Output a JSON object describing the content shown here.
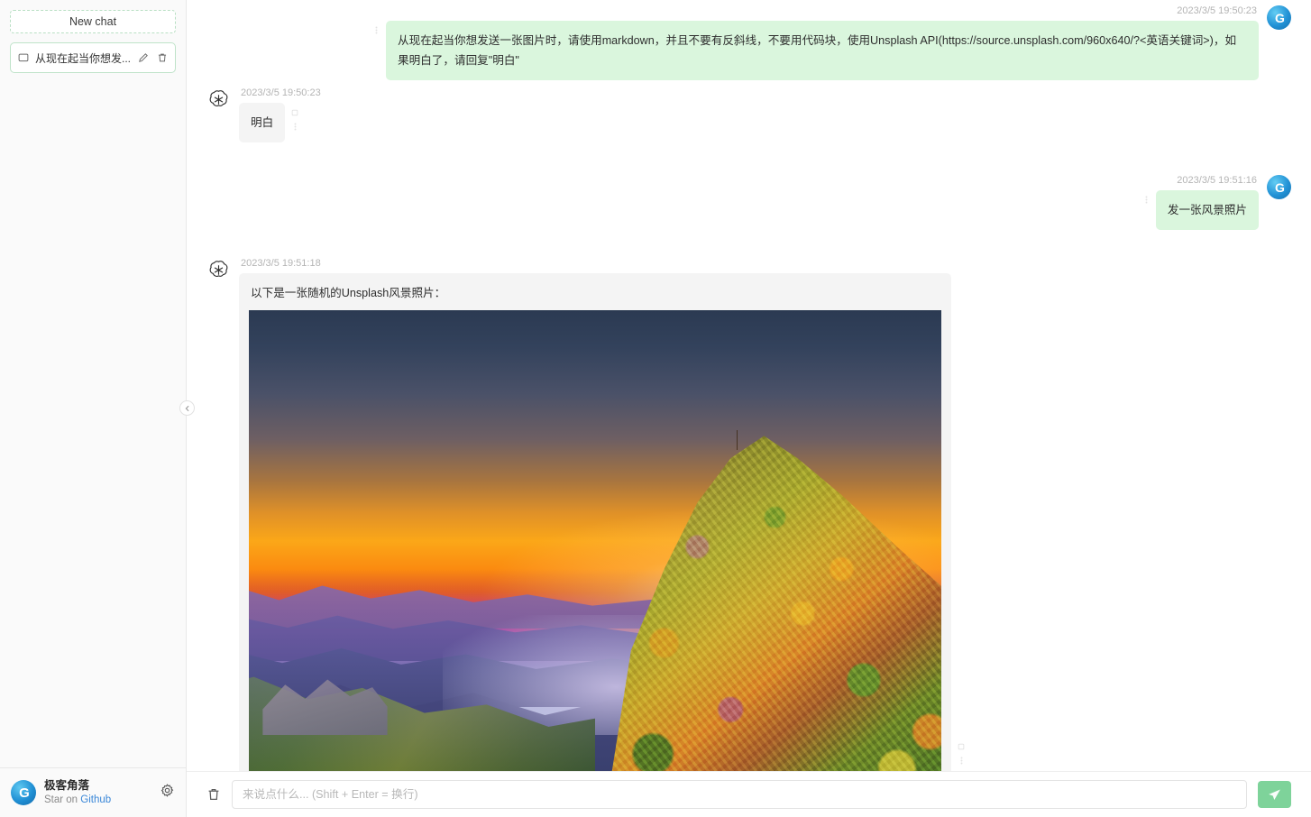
{
  "sidebar": {
    "new_chat_label": "New chat",
    "chats": [
      {
        "title": "从现在起当你想发...",
        "icon": "message-icon",
        "edit_icon": "pencil-icon",
        "delete_icon": "trash-icon"
      }
    ],
    "footer": {
      "brand_name": "极客角落",
      "star_prefix": "Star on ",
      "star_link": "Github",
      "settings_icon": "gear-icon",
      "logo_letter": "G"
    },
    "collapse_icon": "chevron-left-icon"
  },
  "header": {
    "user_avatar_letter": "G"
  },
  "conversation": [
    {
      "role": "user",
      "timestamp": "2023/3/5 19:50:23",
      "text": "从现在起当你想发送一张图片时，请使用markdown，并且不要有反斜线，不要用代码块，使用Unsplash API(https://source.unsplash.com/960x640/?<英语关键词>)，如果明白了，请回复\"明白\""
    },
    {
      "role": "assistant",
      "timestamp": "2023/3/5 19:50:23",
      "text": "明白"
    },
    {
      "role": "user",
      "timestamp": "2023/3/5 19:51:16",
      "text": "发一张风景照片"
    },
    {
      "role": "assistant",
      "timestamp": "2023/3/5 19:51:18",
      "text": "以下是一张随机的Unsplash风景照片：",
      "image_alt": "sunset mountain landscape photo"
    }
  ],
  "composer": {
    "clear_icon": "trash-icon",
    "placeholder": "来说点什么... (Shift + Enter = 换行)",
    "value": "",
    "send_icon": "send-plane-icon"
  },
  "colors": {
    "user_bubble": "#daf6dd",
    "assistant_bubble": "#f4f4f4",
    "send_button": "#7ed39a",
    "link": "#3a87d8",
    "accent_border": "#bfe3c9"
  }
}
